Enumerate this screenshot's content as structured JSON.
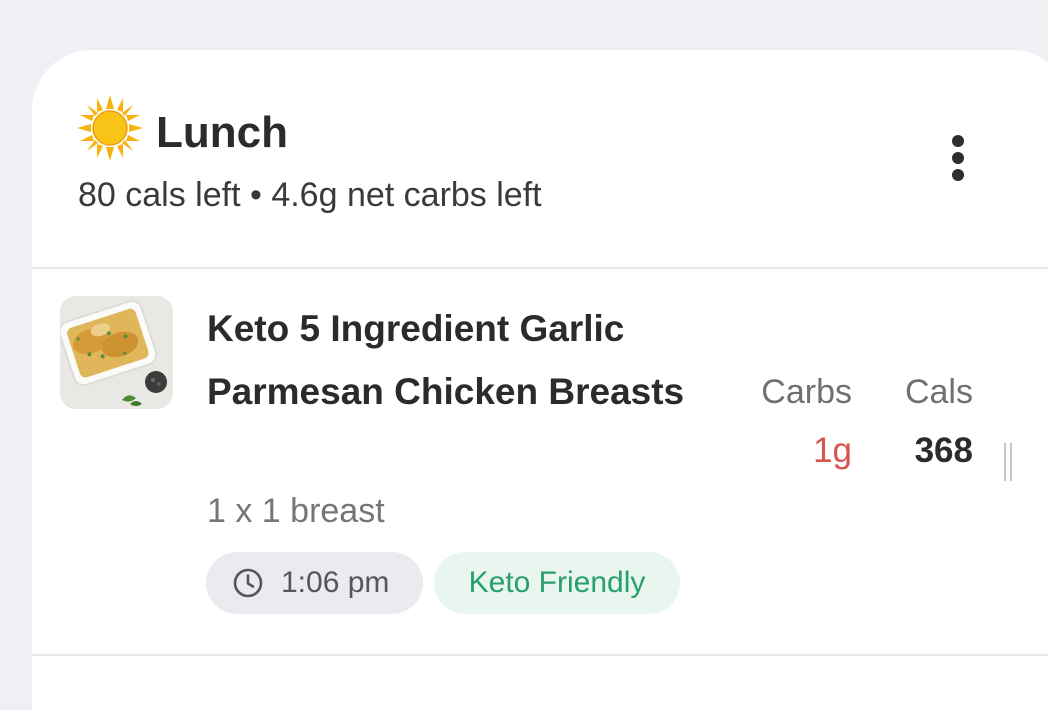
{
  "meal": {
    "icon": "sun-icon",
    "title": "Lunch",
    "summary": "80 cals left • 4.6g net carbs left",
    "menu_icon": "more-vertical-icon"
  },
  "columns": {
    "carbs_label": "Carbs",
    "cals_label": "Cals"
  },
  "food_items": [
    {
      "name": "Keto 5 Ingredient Garlic Parmesan Chicken Breasts",
      "serving": "1 x 1 breast",
      "carbs": "1g",
      "cals": "368",
      "time": "1:06 pm",
      "time_icon": "clock-icon",
      "tag": "Keto Friendly",
      "thumbnail": "food-photo"
    }
  ],
  "colors": {
    "background": "#eef0f4",
    "card": "#ffffff",
    "carbs_value": "#d9534f",
    "tag_text": "#27a06b",
    "tag_bg": "#e8f6ef",
    "time_bg": "#e9ebef"
  }
}
